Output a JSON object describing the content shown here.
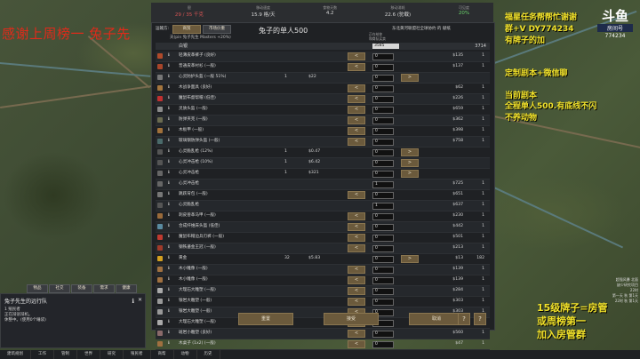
{
  "topbar": [
    {
      "label": "银",
      "value": "29 / 35 千克",
      "tone": "red"
    },
    {
      "label": "移动速度",
      "value": "15.9 格/天",
      "tone": ""
    },
    {
      "label": "食物天数",
      "value": "4.2",
      "tone": ""
    },
    {
      "label": "移动消耗",
      "value": "22.6 (驼载)",
      "tone": ""
    },
    {
      "label": "可见度",
      "value": "20%",
      "tone": "green"
    }
  ],
  "overlay": {
    "thanks": "感谢上周榜一 兔子先",
    "promo1": "福星任务帮帮忙谢谢",
    "promo2": "群+V DY774234",
    "promo3": "有牌子的加",
    "promo4": "定制剧本+微信聊",
    "promo5": "当前剧本",
    "promo6": "全程单人500.有底线不闪",
    "promo7": "不养动物",
    "promo8": "15级牌子=房管",
    "promo9": "或周榜第一",
    "promo10": "加入房管群"
  },
  "logo": {
    "big": "斗鱼",
    "sub": "房间号",
    "num": "774234"
  },
  "panel": {
    "title": "兔子的单人500",
    "tab_label": "运输方:",
    "tab1": "商贸",
    "tab2": "市场价重",
    "sub_header": "天(pin 兔子先生 Masters +20%)",
    "right_header": "东北黄河联盟社全球协约 的 献纸",
    "col_header_1": "正在给你",
    "col_header_2": "和商队买卖",
    "silver_name": "白银",
    "silver_input": "3585",
    "silver_count": "3714",
    "accept": "重置",
    "confirm": "接受",
    "cancel": "取消",
    "help_1": "?",
    "help_2": "?"
  },
  "rows": [
    {
      "name": "轻薄皮革裤子 (良好)",
      "q": "",
      "p": "",
      "lb": "<",
      "inp": "0",
      "rb": "",
      "tp": "$135",
      "tq": "1",
      "color": "#b04a2a"
    },
    {
      "name": "普通皮革衬衫 (一般)",
      "q": "",
      "p": "",
      "lb": "<",
      "inp": "0",
      "rb": "",
      "tp": "$137",
      "tq": "1",
      "color": "#a8452a"
    },
    {
      "name": "心灵防护头盔 (一般 51%)",
      "q": "1",
      "p": "$22",
      "lb": "",
      "inp": "0",
      "rb": ">",
      "tp": "",
      "tq": "",
      "color": "#777"
    },
    {
      "name": "木战争面具 (良好)",
      "q": "",
      "p": "",
      "lb": "<",
      "inp": "0",
      "rb": "",
      "tp": "$62",
      "tq": "1",
      "color": "#a5763e"
    },
    {
      "name": "魔鼠布督帮帽 (低佳)",
      "q": "",
      "p": "",
      "lb": "<",
      "inp": "0",
      "rb": "",
      "tp": "$226",
      "tq": "1",
      "color": "#c03030"
    },
    {
      "name": "灵质头盔 (一般)",
      "q": "",
      "p": "",
      "lb": "<",
      "inp": "0",
      "rb": "",
      "tp": "$659",
      "tq": "1",
      "color": "#8a8a8a"
    },
    {
      "name": "防弹夹克 (一般)",
      "q": "",
      "p": "",
      "lb": "<",
      "inp": "0",
      "rb": "",
      "tp": "$362",
      "tq": "1",
      "color": "#6b6b50"
    },
    {
      "name": "木板甲 (一般)",
      "q": "",
      "p": "",
      "lb": "<",
      "inp": "0",
      "rb": "",
      "tp": "$398",
      "tq": "1",
      "color": "#a0703a"
    },
    {
      "name": "玻璃钢防弹头盔 (一般)",
      "q": "",
      "p": "",
      "lb": "<",
      "inp": "0",
      "rb": "",
      "tp": "$758",
      "tq": "1",
      "color": "#4a6a6a"
    },
    {
      "name": "心灵脆乱枪 (12%)",
      "q": "1",
      "p": "$0.47",
      "lb": "",
      "inp": "0",
      "rb": ">",
      "tp": "",
      "tq": "",
      "color": "#555"
    },
    {
      "name": "心灵冲击枪 (10%)",
      "q": "1",
      "p": "$6.42",
      "lb": "",
      "inp": "0",
      "rb": ">",
      "tp": "",
      "tq": "",
      "color": "#555"
    },
    {
      "name": "心灵冲击枪",
      "q": "1",
      "p": "$321",
      "lb": "",
      "inp": "0",
      "rb": ">",
      "tp": "",
      "tq": "",
      "color": "#666"
    },
    {
      "name": "心灵冲击枪",
      "q": "",
      "p": "",
      "lb": "",
      "inp": "1",
      "rb": "",
      "tp": "$725",
      "tq": "1",
      "color": "#666"
    },
    {
      "name": "跳跃背包 (一般)",
      "q": "",
      "p": "",
      "lb": "<",
      "inp": "0",
      "rb": "",
      "tp": "$651",
      "tq": "1",
      "color": "#777"
    },
    {
      "name": "心灵脆乱枪",
      "q": "",
      "p": "",
      "lb": "",
      "inp": "1",
      "rb": "",
      "tp": "$637",
      "tq": "1",
      "color": "#555"
    },
    {
      "name": "刺皮兽革马甲 (一般)",
      "q": "",
      "p": "",
      "lb": "<",
      "inp": "0",
      "rb": "",
      "tp": "$230",
      "tq": "1",
      "color": "#9a6a3a"
    },
    {
      "name": "合成纤维床头盔 (低佳)",
      "q": "",
      "p": "",
      "lb": "<",
      "inp": "0",
      "rb": "",
      "tp": "$442",
      "tq": "1",
      "color": "#5a8aa0"
    },
    {
      "name": "魔鼠布帽边兵刃裤 (一般)",
      "q": "",
      "p": "",
      "lb": "<",
      "inp": "0",
      "rb": "",
      "tp": "$501",
      "tq": "1",
      "color": "#c03a30"
    },
    {
      "name": "钢铁鎏金王冠 (一般)",
      "q": "",
      "p": "",
      "lb": "<",
      "inp": "0",
      "rb": "",
      "tp": "$213",
      "tq": "1",
      "color": "#a03a2a"
    },
    {
      "name": "黄金",
      "q": "32",
      "p": "$5.83",
      "lb": "",
      "inp": "0",
      "rb": ">",
      "tp": "$13",
      "tq": "182",
      "color": "#d4a020"
    },
    {
      "name": "木小雕像 (一般)",
      "q": "",
      "p": "",
      "lb": "<",
      "inp": "0",
      "rb": "",
      "tp": "$139",
      "tq": "1",
      "color": "#a07040"
    },
    {
      "name": "木小雕像 (一般)",
      "q": "",
      "p": "",
      "lb": "<",
      "inp": "0",
      "rb": "",
      "tp": "$139",
      "tq": "1",
      "color": "#a07040"
    },
    {
      "name": "大理石大雕塑 (一般)",
      "q": "",
      "p": "",
      "lb": "<",
      "inp": "0",
      "rb": "",
      "tp": "$284",
      "tq": "1",
      "color": "#aaa"
    },
    {
      "name": "银岩大雕塑 (一般)",
      "q": "",
      "p": "",
      "lb": "<",
      "inp": "0",
      "rb": "",
      "tp": "$303",
      "tq": "1",
      "color": "#999"
    },
    {
      "name": "银岩大雕塑 (一般)",
      "q": "",
      "p": "",
      "lb": "<",
      "inp": "0",
      "rb": "",
      "tp": "$303",
      "tq": "1",
      "color": "#999"
    },
    {
      "name": "大理石大雕塑 (一般)",
      "q": "",
      "p": "",
      "lb": "<",
      "inp": "0",
      "rb": "",
      "tp": "$353",
      "tq": "1",
      "color": "#aaa"
    },
    {
      "name": "斑岩小雕塑 (良好)",
      "q": "",
      "p": "",
      "lb": "<",
      "inp": "0",
      "rb": "",
      "tp": "$560",
      "tq": "1",
      "color": "#8a6a6a"
    },
    {
      "name": "木桌子 (1x2) (一般)",
      "q": "",
      "p": "",
      "lb": "<",
      "inp": "0",
      "rb": "",
      "tp": "$47",
      "tq": "1",
      "color": "#a07040"
    }
  ],
  "left_tabs": [
    "物品",
    "社交",
    "装备",
    "需求",
    "健康"
  ],
  "colonist": {
    "name": "兔子先生的远行队",
    "line1": "1 殖民者",
    "line2": "正在辩诉辩机。",
    "line3": "休整中。(使用0个睡袋)"
  },
  "statusbar": [
    "建筑规划",
    "工作",
    "管制",
    "世界",
    "研究",
    "殖民者",
    "商帮",
    "动物",
    "历史"
  ],
  "right_info": [
    "超强风暴 北面",
    "缺少研究项目",
    "22时",
    "第一天 秋 第1天",
    "22时 秋 第1天"
  ]
}
